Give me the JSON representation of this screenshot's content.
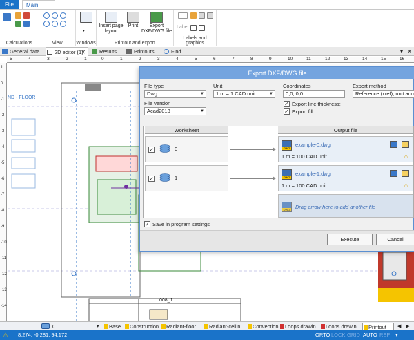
{
  "ribbon_tabs": {
    "file": "File",
    "main": "Main tools"
  },
  "ribbon_groups": {
    "calculations": "Calculations",
    "view": "View",
    "windows": "Windows",
    "printout_export": "Printout and export",
    "labels_graphics": "Labels and graphics"
  },
  "ribbon_buttons": {
    "insert_page_layout_1": "Insert page",
    "insert_page_layout_2": "layout",
    "print": "Print",
    "export_1": "Export",
    "export_2": "DXF/DWG file",
    "label": "Label"
  },
  "doc_tabs": [
    "General data",
    "2D editor (1)",
    "Results",
    "Printouts",
    "Find"
  ],
  "ruler_ticks": [
    "-5",
    "-4",
    "-3",
    "-2",
    "-1",
    "0",
    "1",
    "2",
    "3",
    "4",
    "5",
    "6",
    "7",
    "8",
    "9",
    "10",
    "11",
    "12",
    "13",
    "14",
    "15",
    "16"
  ],
  "vruler_ticks": [
    "1",
    "0",
    "-1",
    "-2",
    "-3",
    "-4",
    "-5",
    "-6",
    "-7",
    "-8",
    "-9",
    "-10",
    "-11",
    "-12",
    "-13",
    "-14"
  ],
  "canvas": {
    "floor_label": "ND - FLOOR",
    "sheet_label": "008_1"
  },
  "dialog": {
    "title": "Export DXF/DWG file",
    "file_type_label": "File type",
    "file_type_value": "Dwg",
    "file_version_label": "File version",
    "file_version_value": "Acad2013",
    "unit_label": "Unit",
    "unit_value": "1 m = 1 CAD unit",
    "coordinates_label": "Coordinates",
    "coordinates_value": "0,0; 0,0",
    "export_method_label": "Export method",
    "export_method_value": "Reference (xref), unit accord",
    "export_line_thickness": "Export line thickness:",
    "export_fill": "Export fill",
    "col_worksheet": "Worksheet",
    "col_output": "Output file",
    "rows": [
      {
        "worksheet": "0",
        "file": "example-0.dwg",
        "unit": "1 m = 100 CAD unit"
      },
      {
        "worksheet": "1",
        "file": "example-1.dwg",
        "unit": "1 m = 100 CAD unit"
      }
    ],
    "drag_hint": "Drag arrow here to add another file",
    "dwg_badge": "DWG",
    "save_settings": "Save in program settings",
    "execute": "Execute",
    "cancel": "Cancel"
  },
  "layers": {
    "current": "0",
    "tabs": [
      "Base",
      "Construction",
      "Radiant-floor...",
      "Radiant-ceilin...",
      "Convection",
      "Loops drawin...",
      "Loops drawin...",
      "Printout"
    ]
  },
  "status": {
    "coords": "8,274; -0,281; 94,172",
    "orto": "ORTO",
    "lock": "LOCK",
    "grid": "GRID",
    "auto": "AUTO",
    "rep": "REP"
  },
  "colors": {
    "accent": "#1a73c9",
    "dialog_title": "#74a4df"
  }
}
